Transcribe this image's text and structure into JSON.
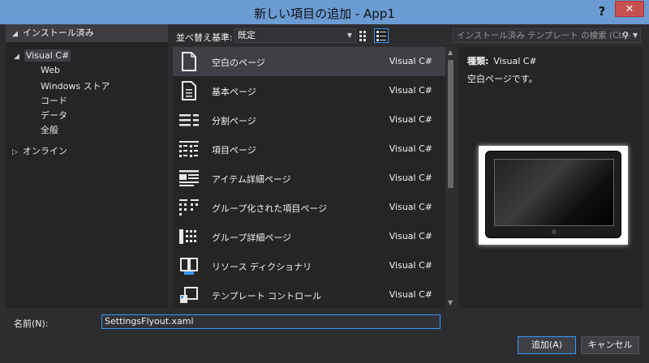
{
  "window": {
    "title": "新しい項目の追加 - App1",
    "help_label": "?",
    "close_label": "✕"
  },
  "left_pane": {
    "header": "インストール済み",
    "tree": {
      "root": "Visual C#",
      "children": [
        "Web",
        "Windows ストア",
        "コード",
        "データ",
        "全般"
      ],
      "online": "オンライン"
    }
  },
  "toolbar": {
    "sort_label": "並べ替え基準:",
    "sort_value": "既定",
    "search_placeholder": "インストール済み テンプレート の検索 (Ctrl-"
  },
  "templates": [
    {
      "name": "空白のページ",
      "lang": "Visual C#",
      "icon": "blank-page-icon",
      "selected": true
    },
    {
      "name": "基本ページ",
      "lang": "Visual C#",
      "icon": "basic-page-icon"
    },
    {
      "name": "分割ページ",
      "lang": "Visual C#",
      "icon": "split-page-icon"
    },
    {
      "name": "項目ページ",
      "lang": "Visual C#",
      "icon": "items-page-icon"
    },
    {
      "name": "アイテム詳細ページ",
      "lang": "Visual C#",
      "icon": "item-detail-page-icon"
    },
    {
      "name": "グループ化された項目ページ",
      "lang": "Visual C#",
      "icon": "grouped-items-page-icon"
    },
    {
      "name": "グループ詳細ページ",
      "lang": "Visual C#",
      "icon": "group-detail-page-icon"
    },
    {
      "name": "リソース ディクショナリ",
      "lang": "Visual C#",
      "icon": "resource-dictionary-icon"
    },
    {
      "name": "テンプレート コントロール",
      "lang": "Visual C#",
      "icon": "templated-control-icon"
    }
  ],
  "detail": {
    "type_label": "種類:",
    "type_value": "Visual C#",
    "description": "空白ページです。"
  },
  "footer": {
    "name_label": "名前(N):",
    "name_value": "SettingsFlyout.xaml",
    "add_button": "追加(A)",
    "cancel_button": "キャンセル"
  },
  "colors": {
    "titlebar": "#6b9bd3",
    "background": "#2d2d30",
    "accent": "#3399ff",
    "close": "#c75050"
  }
}
